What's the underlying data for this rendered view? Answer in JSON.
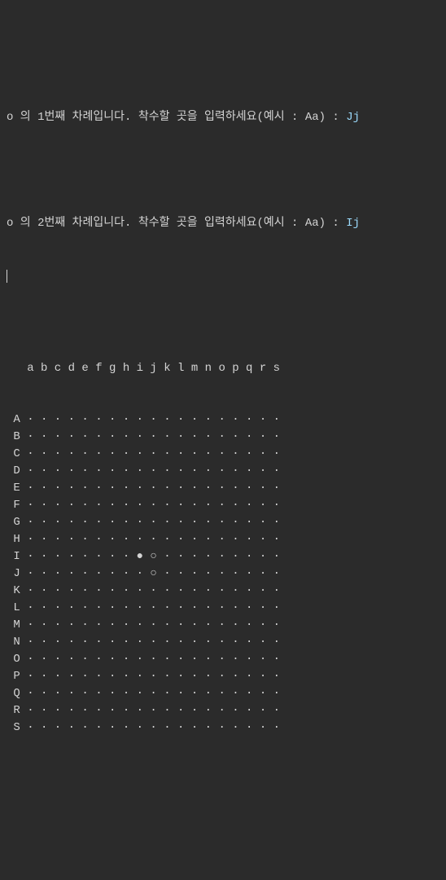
{
  "prompts": [
    {
      "player": "o",
      "turn_text": " 의 1번째 차례입니다. 착수할 곳을 입력하세요(예시 : Aa) : ",
      "input": "Jj"
    },
    {
      "player": "o",
      "turn_text": " 의 2번째 차례입니다. 착수할 곳을 입력하세요(예시 : Aa) : ",
      "input": "Ij"
    }
  ],
  "board": {
    "columns": [
      "a",
      "b",
      "c",
      "d",
      "e",
      "f",
      "g",
      "h",
      "i",
      "j",
      "k",
      "l",
      "m",
      "n",
      "o",
      "p",
      "q",
      "r",
      "s"
    ],
    "rows": [
      "A",
      "B",
      "C",
      "D",
      "E",
      "F",
      "G",
      "H",
      "I",
      "J",
      "K",
      "L",
      "M",
      "N",
      "O",
      "P",
      "Q",
      "R",
      "S"
    ],
    "empty_symbol": "·",
    "white_stone": "●",
    "black_stone": "○",
    "stones": [
      {
        "row": "I",
        "col": "i",
        "color": "white"
      },
      {
        "row": "I",
        "col": "j",
        "color": "black"
      },
      {
        "row": "J",
        "col": "j",
        "color": "black"
      }
    ]
  }
}
